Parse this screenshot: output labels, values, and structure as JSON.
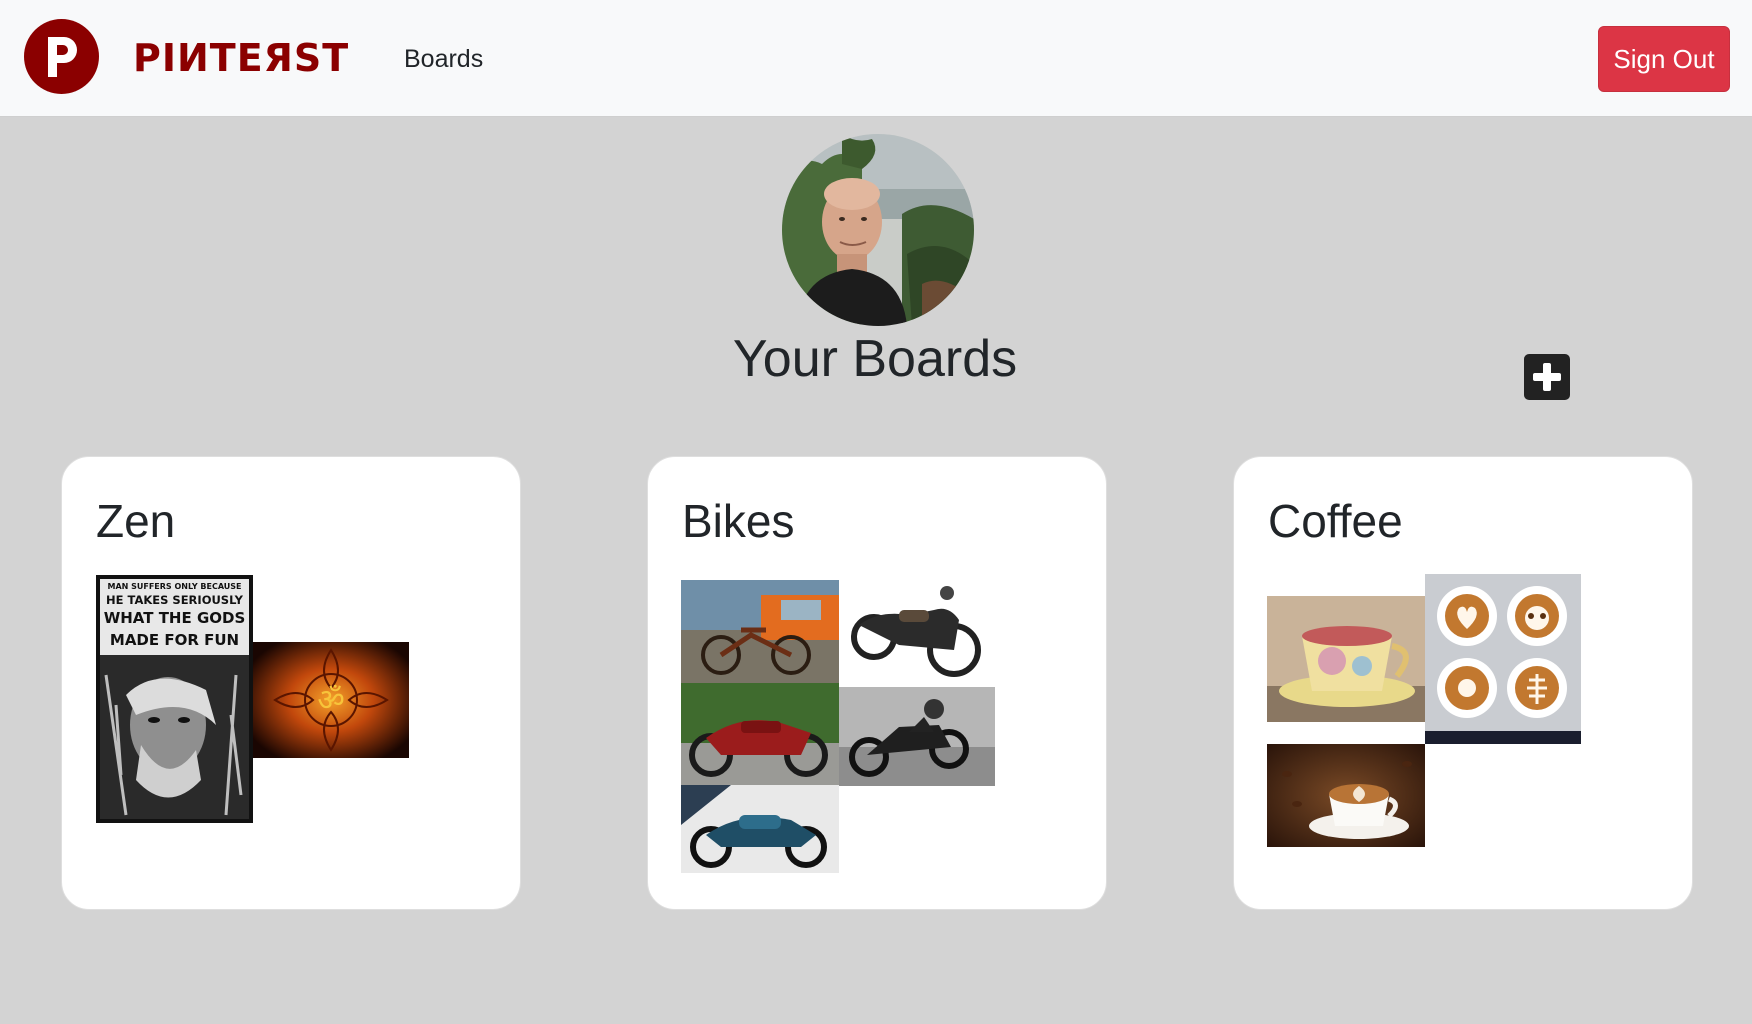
{
  "app": {
    "brand": "PIИTEЯST",
    "nav_boards": "Boards",
    "sign_out": "Sign Out"
  },
  "profile": {
    "heading": "Your Boards"
  },
  "boards": [
    {
      "title": "Zen",
      "poster_text": [
        "MAN SUFFERS ONLY BECAUSE",
        "HE TAKES SERIOUSLY",
        "WHAT THE GODS",
        "MADE FOR FUN"
      ]
    },
    {
      "title": "Bikes"
    },
    {
      "title": "Coffee"
    }
  ],
  "icons": {
    "logo": "pinterest-logo",
    "add": "plus-square-icon"
  },
  "colors": {
    "brand": "#8b0000",
    "signout": "#dc3545",
    "background": "#d3d3d3",
    "navbar": "#f8f9fa"
  }
}
